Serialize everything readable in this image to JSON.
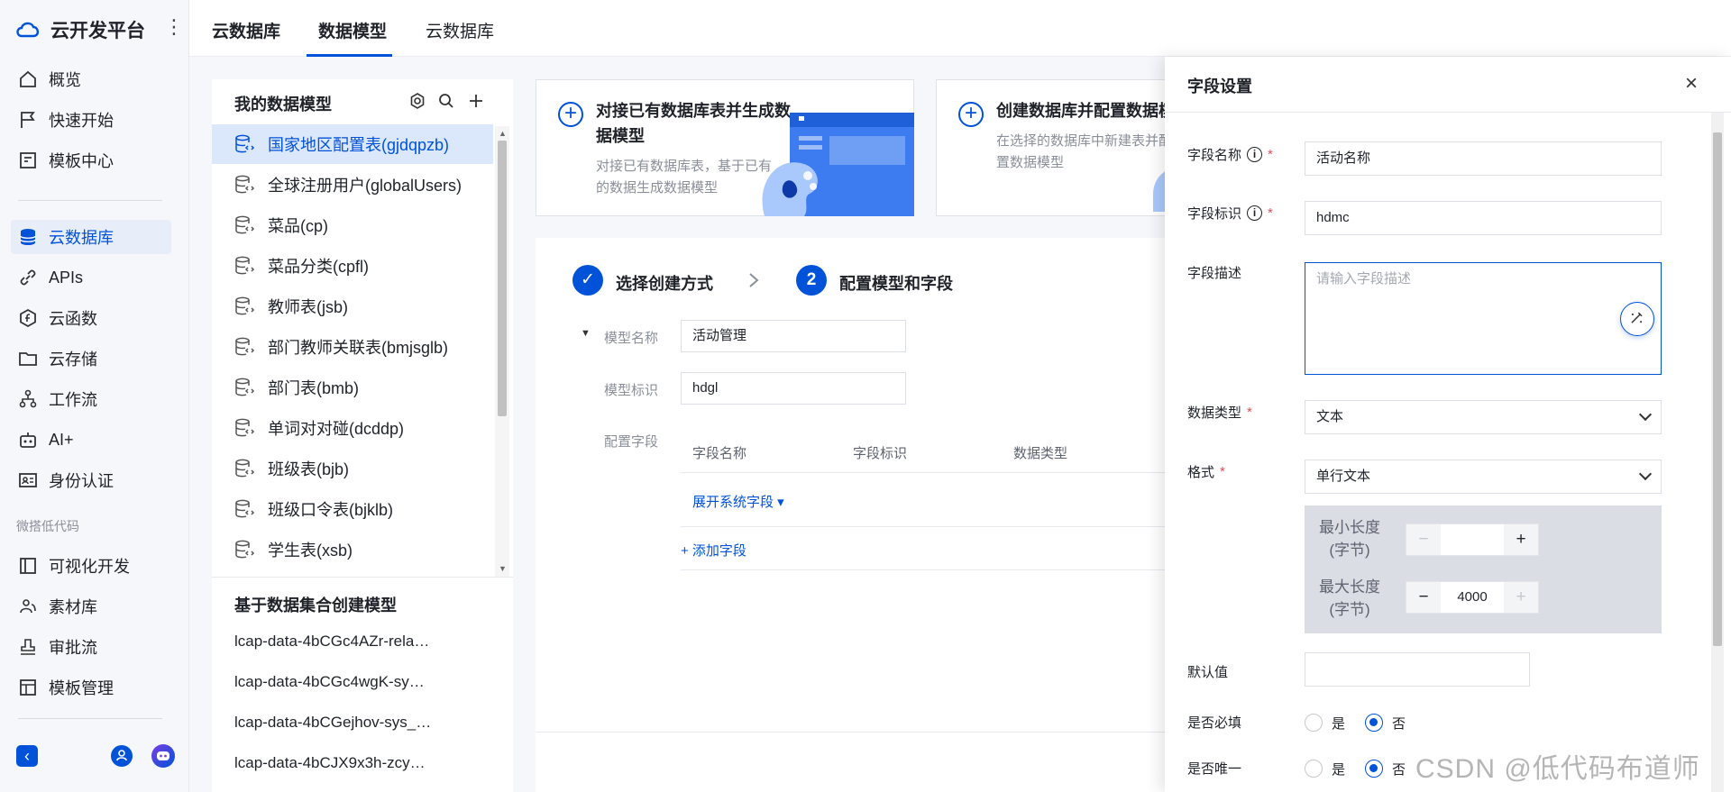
{
  "app": {
    "title": "云开发平台"
  },
  "nav": {
    "items": [
      {
        "label": "概览",
        "icon": "home-icon"
      },
      {
        "label": "快速开始",
        "icon": "flag-icon"
      },
      {
        "label": "模板中心",
        "icon": "template-icon"
      },
      {
        "label": "云数据库",
        "icon": "database-icon",
        "active": true
      },
      {
        "label": "APIs",
        "icon": "link-icon"
      },
      {
        "label": "云函数",
        "icon": "function-icon"
      },
      {
        "label": "云存储",
        "icon": "folder-icon"
      },
      {
        "label": "工作流",
        "icon": "workflow-icon"
      },
      {
        "label": "AI+",
        "icon": "robot-icon"
      },
      {
        "label": "身份认证",
        "icon": "id-card-icon"
      }
    ],
    "group_label": "微搭低代码",
    "lowcode_items": [
      {
        "label": "可视化开发",
        "icon": "layout-icon"
      },
      {
        "label": "素材库",
        "icon": "people-icon"
      },
      {
        "label": "审批流",
        "icon": "stamp-icon"
      },
      {
        "label": "模板管理",
        "icon": "template-manage-icon"
      }
    ]
  },
  "topbar": {
    "tabs": [
      {
        "label": "云数据库"
      },
      {
        "label": "数据模型",
        "active": true
      },
      {
        "label": "云数据库"
      }
    ]
  },
  "models": {
    "title": "我的数据模型",
    "items": [
      {
        "label": "国家地区配置表(gjdqpzb)",
        "selected": true
      },
      {
        "label": "全球注册用户(globalUsers)"
      },
      {
        "label": "菜品(cp)"
      },
      {
        "label": "菜品分类(cpfl)"
      },
      {
        "label": "教师表(jsb)"
      },
      {
        "label": "部门教师关联表(bmjsglb)"
      },
      {
        "label": "部门表(bmb)"
      },
      {
        "label": "单词对对碰(dcddp)"
      },
      {
        "label": "班级表(bjb)"
      },
      {
        "label": "班级口令表(bjklb)"
      },
      {
        "label": "学生表(xsb)"
      }
    ],
    "dataset_title": "基于数据集合创建模型",
    "datasets": [
      "lcap-data-4bCGc4AZr-rela…",
      "lcap-data-4bCGc4wgK-sy…",
      "lcap-data-4bCGejhov-sys_…",
      "lcap-data-4bCJX9x3h-zcy…"
    ]
  },
  "cards": [
    {
      "title": "对接已有数据库表并生成数据模型",
      "desc": "对接已有数据库表，基于已有的数据生成数据模型"
    },
    {
      "title": "创建数据库并配置数据模",
      "desc": "在选择的数据库中新建表并配置数据模型"
    }
  ],
  "steps": [
    {
      "label": "选择创建方式",
      "number": "✓"
    },
    {
      "label": "配置模型和字段",
      "number": "2"
    }
  ],
  "form": {
    "model_name_label": "模型名称",
    "model_name": "活动管理",
    "model_id_label": "模型标识",
    "model_id": "hdgl",
    "fields_label": "配置字段",
    "columns": [
      "字段名称",
      "字段标识",
      "数据类型"
    ],
    "expand_system": "展开系统字段 ▾",
    "add_field": "+ 添加字段"
  },
  "drawer": {
    "title": "字段设置",
    "field_name_label": "字段名称",
    "field_name": "活动名称",
    "field_id_label": "字段标识",
    "field_id": "hdmc",
    "desc_label": "字段描述",
    "desc_placeholder": "请输入字段描述",
    "type_label": "数据类型",
    "type_value": "文本",
    "format_label": "格式",
    "format_value": "单行文本",
    "min_label": "最小长度(字节)",
    "min_value": "",
    "max_label": "最大长度(字节)",
    "max_value": "4000",
    "default_label": "默认值",
    "default_value": "",
    "required_label": "是否必填",
    "unique_label": "是否唯一",
    "yes": "是",
    "no": "否",
    "required_value": "否",
    "unique_value": "否"
  },
  "watermark": "CSDN @低代码布道师",
  "colors": {
    "accent": "#0052d9",
    "required": "#e34d59"
  }
}
